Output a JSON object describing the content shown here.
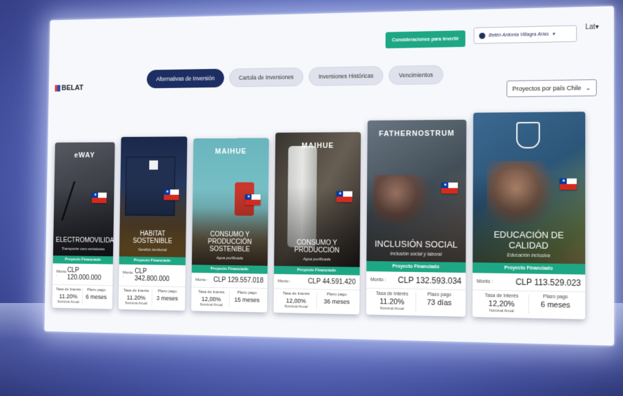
{
  "header": {
    "consider_label": "Consideraciones para Invertir",
    "user_name": "Belén Antonia Villagra Arias",
    "lang": "Lat"
  },
  "logo": "BELAT",
  "tabs": [
    {
      "label": "Alternativas de Inversión",
      "active": true
    },
    {
      "label": "Cartola de Inversiones",
      "active": false
    },
    {
      "label": "Inversiones Históricas",
      "active": false
    },
    {
      "label": "Vencimientos",
      "active": false
    }
  ],
  "country_filter": "Proyectos por país Chile",
  "labels": {
    "monto": "Monto :",
    "tasa": "Tasa de Interés",
    "plazo": "Plazo pago",
    "nominal": "Nominal Anual"
  },
  "cards": [
    {
      "brand": "eWAY",
      "title": "ELECTROMOVILIDAD",
      "subtitle": "Transporte cero emisiones",
      "status": "Proyecto Financiado",
      "monto": "CLP 120.000.000",
      "tasa": "11.20%",
      "plazo": "6 meses"
    },
    {
      "brand": "",
      "title": "HABITAT SOSTENIBLE",
      "subtitle": "Gestión territorial",
      "status": "Proyecto Financiado",
      "monto": "CLP 342.800.000",
      "tasa": "11.20%",
      "plazo": "3 meses"
    },
    {
      "brand": "MAIHUE",
      "title": "CONSUMO Y PRODUCCIÓN SOSTENIBLE",
      "subtitle": "Agua purificada",
      "status": "Proyecto Financiado",
      "monto": "CLP 129.557.018",
      "tasa": "12,00%",
      "plazo": "15 meses"
    },
    {
      "brand": "MAIHUE",
      "title": "CONSUMO Y PRODUCCIÓN",
      "subtitle": "Agua purificada",
      "status": "Proyecto Financiado",
      "monto": "CLP 44.591.420",
      "tasa": "12,00%",
      "plazo": "36 meses"
    },
    {
      "brand": "FATHERNOSTRUM",
      "title": "INCLUSIÓN SOCIAL",
      "subtitle": "Inclusión social y laboral",
      "status": "Proyecto Financiado",
      "monto": "CLP 132.593.034",
      "tasa": "11.20%",
      "plazo": "73 días"
    },
    {
      "brand": "",
      "title": "EDUCACIÓN DE CALIDAD",
      "subtitle": "Educación inclusiva",
      "status": "Proyecto Financiado",
      "monto": "CLP 113.529.023",
      "tasa": "12,20%",
      "plazo": "6 meses"
    }
  ],
  "colors": {
    "primary": "#1d2e63",
    "accent": "#1ea784",
    "flag_red": "#d52b1e",
    "flag_blue": "#0039a6"
  }
}
